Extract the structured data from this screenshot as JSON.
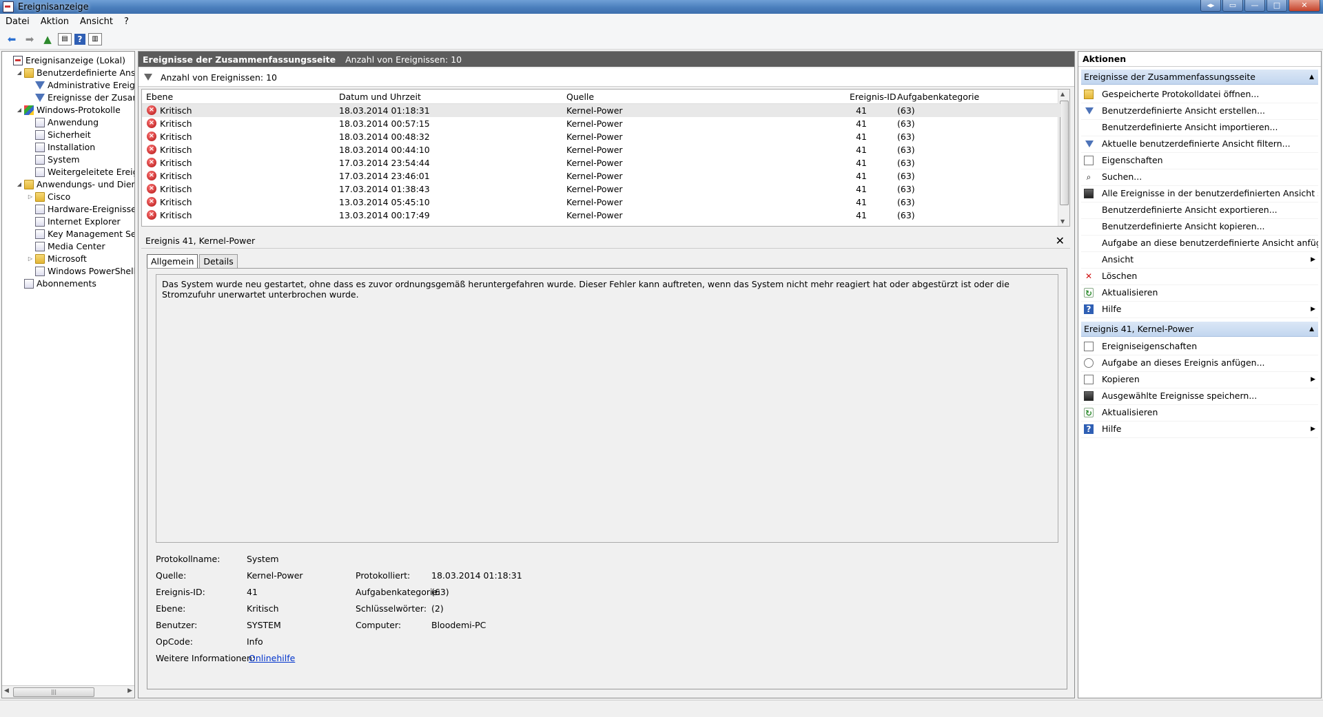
{
  "window": {
    "title": "Ereignisanzeige"
  },
  "menu": [
    "Datei",
    "Aktion",
    "Ansicht",
    "?"
  ],
  "tree": {
    "nodes": [
      {
        "label": "Ereignisanzeige (Lokal)",
        "level": 0,
        "icon": "root-icon",
        "expand": ""
      },
      {
        "label": "Benutzerdefinierte Ansichten",
        "level": 1,
        "icon": "folder-icon",
        "expand": "◢"
      },
      {
        "label": "Administrative Ereignisse",
        "level": 2,
        "icon": "filter-icon",
        "expand": ""
      },
      {
        "label": "Ereignisse der Zusammenfassungsseite",
        "level": 2,
        "icon": "filter-icon",
        "expand": ""
      },
      {
        "label": "Windows-Protokolle",
        "level": 1,
        "icon": "windows-icon",
        "expand": "◢"
      },
      {
        "label": "Anwendung",
        "level": 2,
        "icon": "log-icon",
        "expand": ""
      },
      {
        "label": "Sicherheit",
        "level": 2,
        "icon": "log-icon",
        "expand": ""
      },
      {
        "label": "Installation",
        "level": 2,
        "icon": "log-icon",
        "expand": ""
      },
      {
        "label": "System",
        "level": 2,
        "icon": "log-icon",
        "expand": ""
      },
      {
        "label": "Weitergeleitete Ereignisse",
        "level": 2,
        "icon": "log-icon",
        "expand": ""
      },
      {
        "label": "Anwendungs- und Dienstprotokolle",
        "level": 1,
        "icon": "folder-icon",
        "expand": "◢"
      },
      {
        "label": "Cisco",
        "level": 2,
        "icon": "folder-icon",
        "expand": "▷"
      },
      {
        "label": "Hardware-Ereignisse",
        "level": 2,
        "icon": "log-icon",
        "expand": ""
      },
      {
        "label": "Internet Explorer",
        "level": 2,
        "icon": "log-icon",
        "expand": ""
      },
      {
        "label": "Key Management Service",
        "level": 2,
        "icon": "log-icon",
        "expand": ""
      },
      {
        "label": "Media Center",
        "level": 2,
        "icon": "log-icon",
        "expand": ""
      },
      {
        "label": "Microsoft",
        "level": 2,
        "icon": "folder-icon",
        "expand": "▷"
      },
      {
        "label": "Windows PowerShell",
        "level": 2,
        "icon": "log-icon",
        "expand": ""
      },
      {
        "label": "Abonnements",
        "level": 1,
        "icon": "log-icon",
        "expand": ""
      }
    ]
  },
  "center": {
    "title": "Ereignisse der Zusammenfassungsseite",
    "count_label": "Anzahl von Ereignissen: 10",
    "filter_label": "Anzahl von Ereignissen: 10",
    "columns": [
      "Ebene",
      "Datum und Uhrzeit",
      "Quelle",
      "Ereignis-ID",
      "Aufgabenkategorie"
    ],
    "rows": [
      {
        "level": "Kritisch",
        "date": "18.03.2014 01:18:31",
        "source": "Kernel-Power",
        "id": "41",
        "category": "(63)"
      },
      {
        "level": "Kritisch",
        "date": "18.03.2014 00:57:15",
        "source": "Kernel-Power",
        "id": "41",
        "category": "(63)"
      },
      {
        "level": "Kritisch",
        "date": "18.03.2014 00:48:32",
        "source": "Kernel-Power",
        "id": "41",
        "category": "(63)"
      },
      {
        "level": "Kritisch",
        "date": "18.03.2014 00:44:10",
        "source": "Kernel-Power",
        "id": "41",
        "category": "(63)"
      },
      {
        "level": "Kritisch",
        "date": "17.03.2014 23:54:44",
        "source": "Kernel-Power",
        "id": "41",
        "category": "(63)"
      },
      {
        "level": "Kritisch",
        "date": "17.03.2014 23:46:01",
        "source": "Kernel-Power",
        "id": "41",
        "category": "(63)"
      },
      {
        "level": "Kritisch",
        "date": "17.03.2014 01:38:43",
        "source": "Kernel-Power",
        "id": "41",
        "category": "(63)"
      },
      {
        "level": "Kritisch",
        "date": "13.03.2014 05:45:10",
        "source": "Kernel-Power",
        "id": "41",
        "category": "(63)"
      },
      {
        "level": "Kritisch",
        "date": "13.03.2014 00:17:49",
        "source": "Kernel-Power",
        "id": "41",
        "category": "(63)"
      }
    ]
  },
  "detail": {
    "title": "Ereignis 41, Kernel-Power",
    "tabs": [
      "Allgemein",
      "Details"
    ],
    "description": "Das System wurde neu gestartet, ohne dass es zuvor ordnungsgemäß heruntergefahren wurde. Dieser Fehler kann auftreten, wenn das System nicht mehr reagiert hat oder abgestürzt ist oder die Stromzufuhr unerwartet unterbrochen wurde.",
    "props": {
      "log_name_label": "Protokollname:",
      "log_name": "System",
      "source_label": "Quelle:",
      "source": "Kernel-Power",
      "logged_label": "Protokolliert:",
      "logged": "18.03.2014 01:18:31",
      "event_id_label": "Ereignis-ID:",
      "event_id": "41",
      "task_cat_label": "Aufgabenkategorie:",
      "task_cat": "(63)",
      "level_label": "Ebene:",
      "level": "Kritisch",
      "keywords_label": "Schlüsselwörter:",
      "keywords": "(2)",
      "user_label": "Benutzer:",
      "user": "SYSTEM",
      "computer_label": "Computer:",
      "computer": "Bloodemi-PC",
      "opcode_label": "OpCode:",
      "opcode": "Info",
      "more_info_label": "Weitere Informationen:",
      "more_info_link": "Onlinehilfe"
    }
  },
  "actions": {
    "title": "Aktionen",
    "section1": "Ereignisse der Zusammenfassungsseite",
    "items1": [
      {
        "label": "Gespeicherte Protokolldatei öffnen...",
        "icon": "open-icon",
        "sub": ""
      },
      {
        "label": "Benutzerdefinierte Ansicht erstellen...",
        "icon": "filter-icon",
        "sub": ""
      },
      {
        "label": "Benutzerdefinierte Ansicht importieren...",
        "icon": "",
        "sub": ""
      },
      {
        "label": "Aktuelle benutzerdefinierte Ansicht filtern...",
        "icon": "filter-icon",
        "sub": ""
      },
      {
        "label": "Eigenschaften",
        "icon": "properties-icon",
        "sub": ""
      },
      {
        "label": "Suchen...",
        "icon": "binoculars-icon",
        "sub": ""
      },
      {
        "label": "Alle Ereignisse in der benutzerdefinierten Ansicht speic...",
        "icon": "save-icon",
        "sub": ""
      },
      {
        "label": "Benutzerdefinierte Ansicht exportieren...",
        "icon": "",
        "sub": ""
      },
      {
        "label": "Benutzerdefinierte Ansicht kopieren...",
        "icon": "",
        "sub": ""
      },
      {
        "label": "Aufgabe an diese benutzerdefinierte Ansicht anfügen...",
        "icon": "",
        "sub": ""
      },
      {
        "label": "Ansicht",
        "icon": "",
        "sub": "▶"
      },
      {
        "label": "Löschen",
        "icon": "delete-icon",
        "sub": ""
      },
      {
        "label": "Aktualisieren",
        "icon": "refresh-icon",
        "sub": ""
      },
      {
        "label": "Hilfe",
        "icon": "help-icon",
        "sub": "▶"
      }
    ],
    "section2": "Ereignis 41, Kernel-Power",
    "items2": [
      {
        "label": "Ereigniseigenschaften",
        "icon": "properties-icon",
        "sub": ""
      },
      {
        "label": "Aufgabe an dieses Ereignis anfügen...",
        "icon": "task-icon",
        "sub": ""
      },
      {
        "label": "Kopieren",
        "icon": "copy-icon",
        "sub": "▶"
      },
      {
        "label": "Ausgewählte Ereignisse speichern...",
        "icon": "save-icon",
        "sub": ""
      },
      {
        "label": "Aktualisieren",
        "icon": "refresh-icon",
        "sub": ""
      },
      {
        "label": "Hilfe",
        "icon": "help-icon",
        "sub": "▶"
      }
    ]
  }
}
